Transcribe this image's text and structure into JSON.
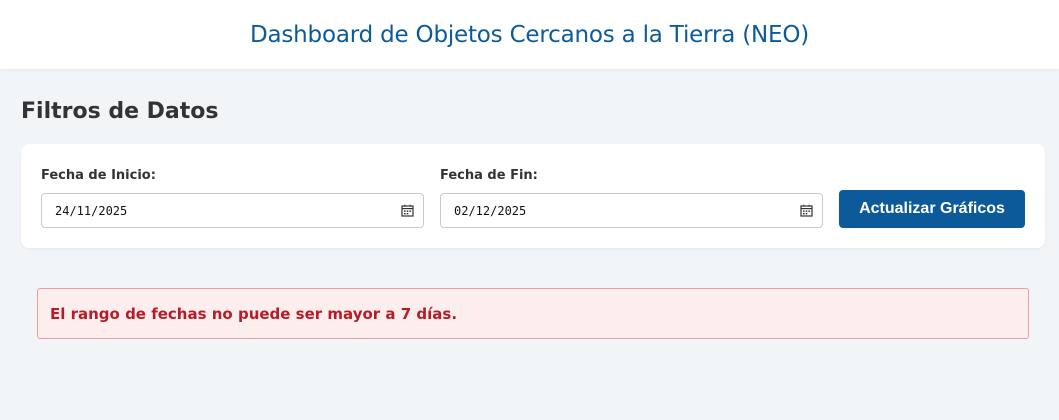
{
  "header": {
    "title": "Dashboard de Objetos Cercanos a la Tierra (NEO)"
  },
  "filters": {
    "section_title": "Filtros de Datos",
    "start_date": {
      "label": "Fecha de Inicio:",
      "value": "24/11/2025"
    },
    "end_date": {
      "label": "Fecha de Fin:",
      "value": "02/12/2025"
    },
    "update_button": "Actualizar Gráficos"
  },
  "error": {
    "message": "El rango de fechas no puede ser mayor a 7 días."
  },
  "colors": {
    "accent": "#0c5a99",
    "background": "#f2f5f8",
    "error_text": "#b51c28",
    "error_bg": "#fdeeee",
    "error_border": "#ef9ca2"
  },
  "icons": {
    "date_picker": "calendar-icon"
  }
}
